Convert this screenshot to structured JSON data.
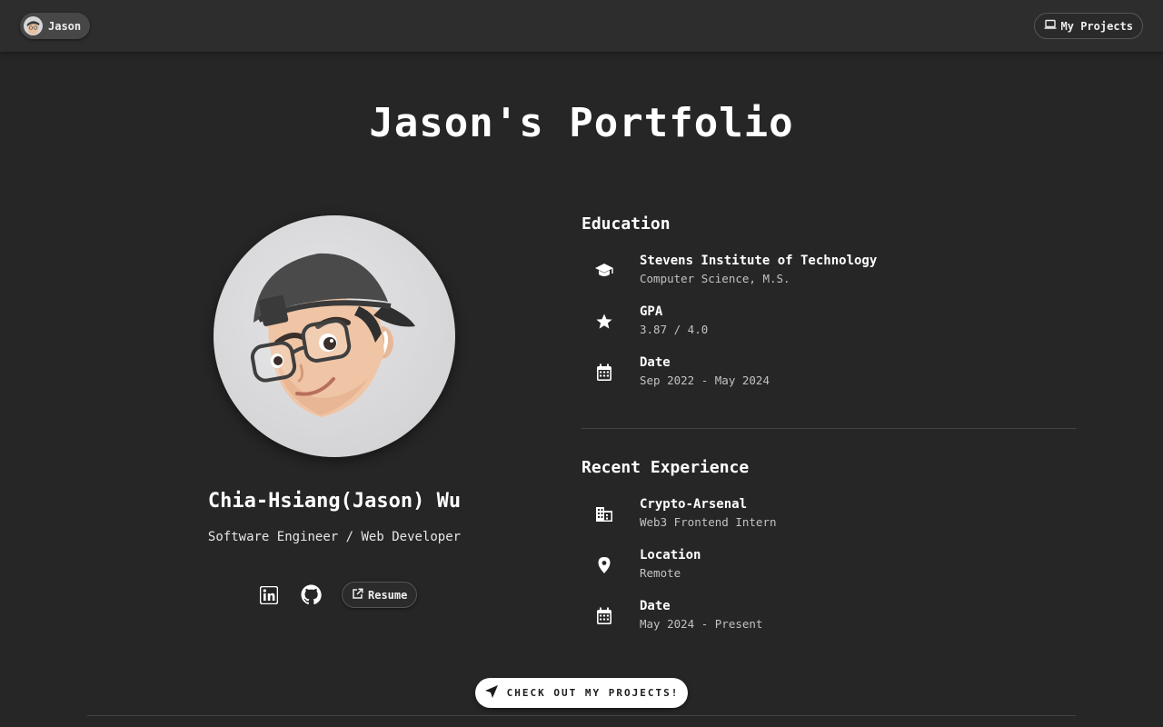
{
  "nav": {
    "user_label": "Jason",
    "projects_label": "My Projects"
  },
  "hero": {
    "title": "Jason's Portfolio"
  },
  "profile": {
    "name": "Chia-Hsiang(Jason) Wu",
    "role": "Software Engineer / Web Developer",
    "social": [
      "linkedin-icon",
      "github-icon"
    ],
    "resume_label": "Resume"
  },
  "education": {
    "title": "Education",
    "items": [
      {
        "icon": "graduation-cap-icon",
        "label": "Stevens Institute of Technology",
        "value": "Computer Science, M.S."
      },
      {
        "icon": "star-icon",
        "label": "GPA",
        "value": "3.87 / 4.0"
      },
      {
        "icon": "calendar-icon",
        "label": "Date",
        "value": "Sep 2022 - May 2024"
      }
    ]
  },
  "experience": {
    "title": "Recent Experience",
    "items": [
      {
        "icon": "building-icon",
        "label": "Crypto-Arsenal",
        "value": "Web3 Frontend Intern"
      },
      {
        "icon": "location-pin-icon",
        "label": "Location",
        "value": "Remote"
      },
      {
        "icon": "calendar-icon",
        "label": "Date",
        "value": "May 2024 - Present"
      }
    ]
  },
  "cta": {
    "label": "CHECK OUT MY PROJECTS!"
  },
  "colors": {
    "background": "#262626",
    "topbar": "#2d2d2d",
    "cta_background": "#ffffff"
  }
}
